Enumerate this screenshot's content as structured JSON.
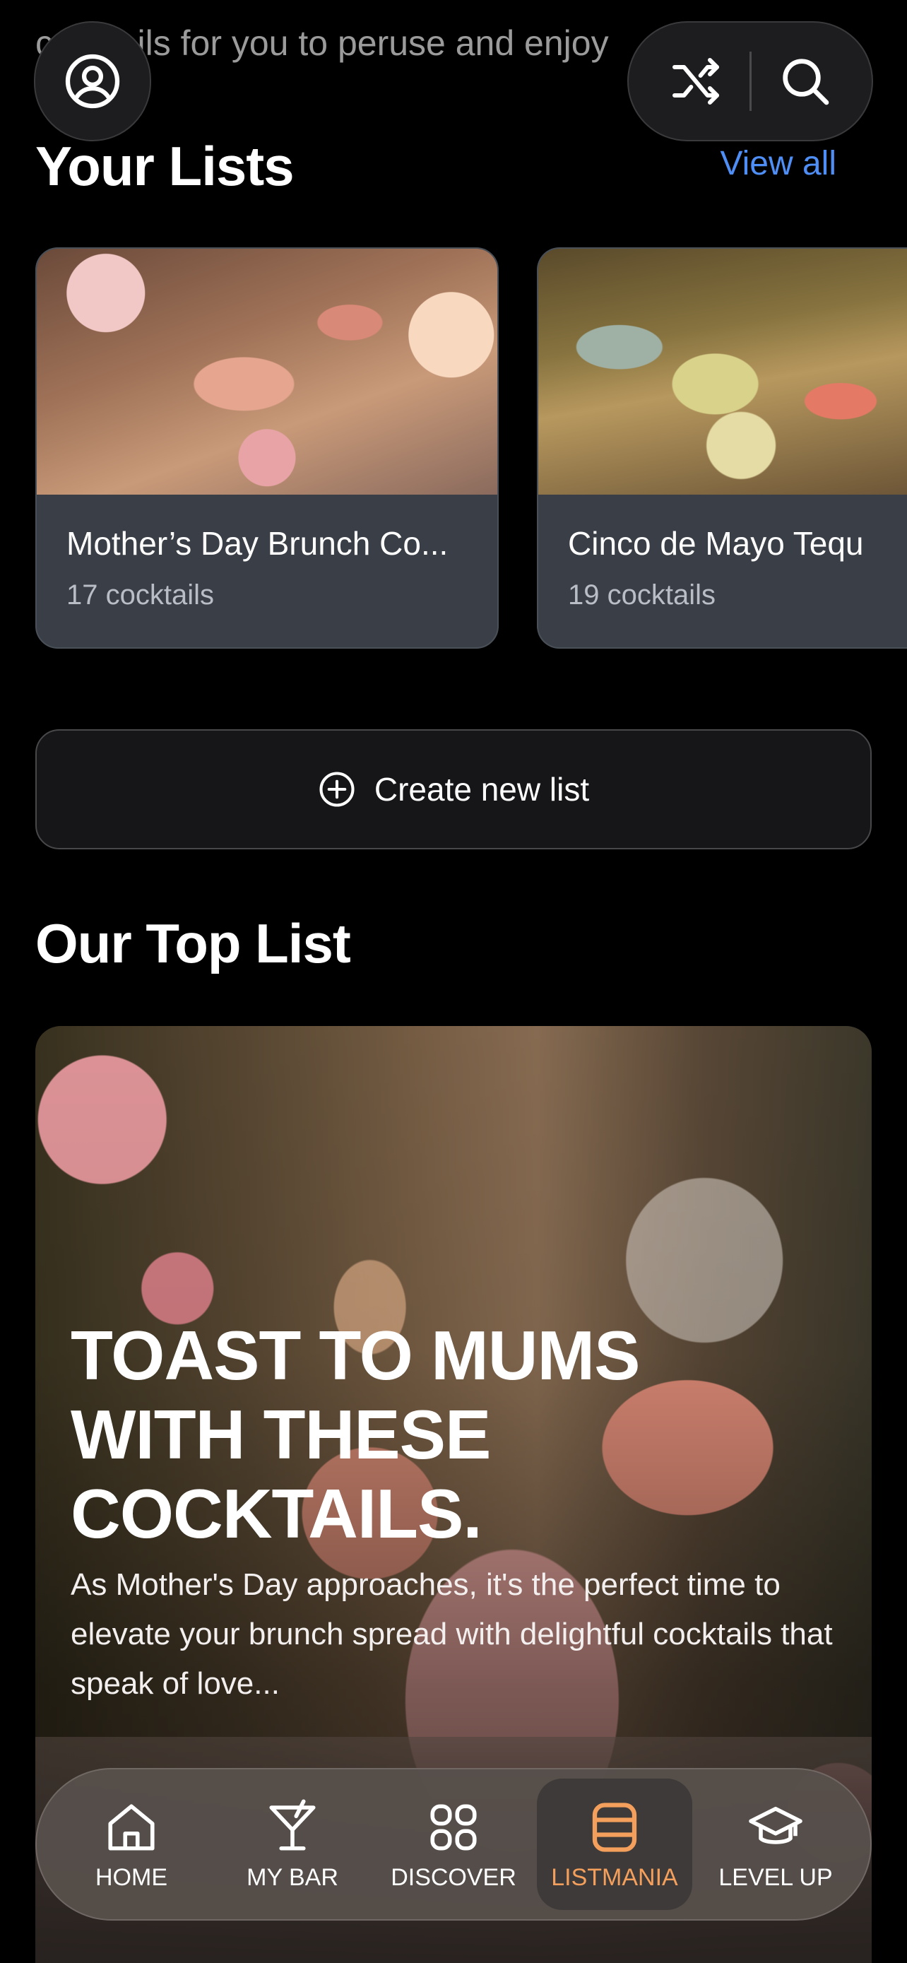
{
  "header": {
    "intro_text": "cocktails for you to peruse and enjoy"
  },
  "your_lists": {
    "title": "Your Lists",
    "view_all": "View all",
    "cards": [
      {
        "title": "Mother’s Day Brunch Co...",
        "count": "17 cocktails"
      },
      {
        "title": "Cinco de Mayo Tequ",
        "count": "19 cocktails"
      }
    ]
  },
  "create_list": {
    "label": "Create new list"
  },
  "top_list": {
    "title": "Our Top List",
    "headline": "TOAST TO MUMS WITH THESE COCKTAILS.",
    "description": "As Mother's Day approaches, it's the perfect time to elevate your brunch spread with delightful cocktails that speak of love..."
  },
  "tabs": [
    {
      "label": "HOME",
      "icon": "home-icon",
      "active": false
    },
    {
      "label": "MY BAR",
      "icon": "cocktail-glass-icon",
      "active": false
    },
    {
      "label": "DISCOVER",
      "icon": "grid-icon",
      "active": false
    },
    {
      "label": "LISTMANIA",
      "icon": "list-icon",
      "active": true
    },
    {
      "label": "LEVEL UP",
      "icon": "graduation-cap-icon",
      "active": false
    }
  ],
  "colors": {
    "accent_link": "#4f8ef5",
    "active_tab": "#f4a05c",
    "background": "#000000"
  }
}
